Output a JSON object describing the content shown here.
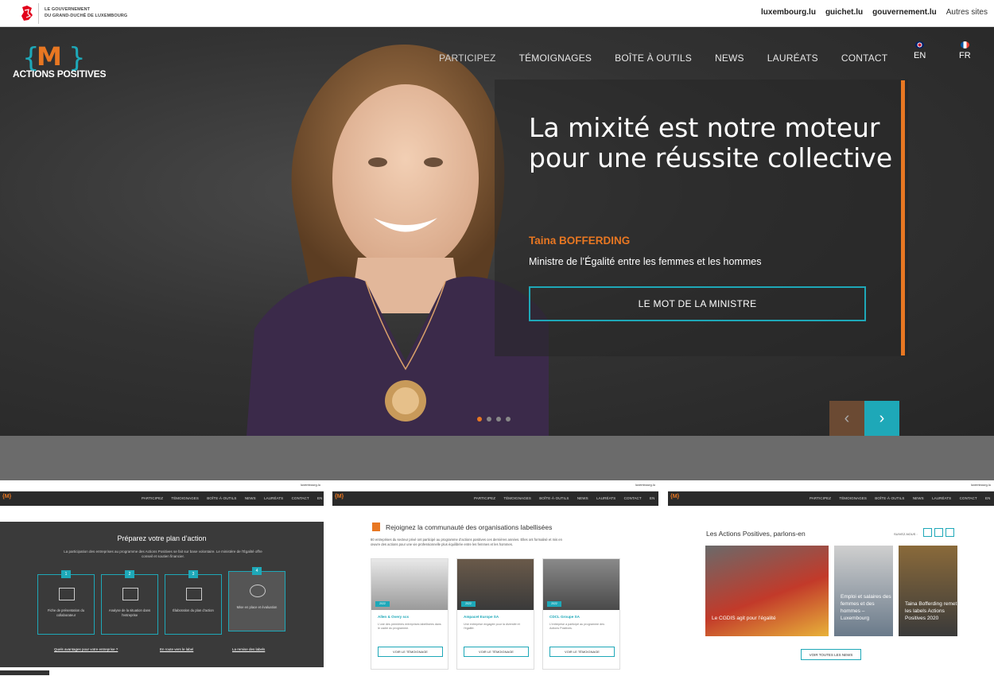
{
  "gov_bar": {
    "logo_text_line1": "LE GOUVERNEMENT",
    "logo_text_line2": "DU GRAND-DUCHÉ DE LUXEMBOURG",
    "links": [
      "luxembourg.lu",
      "guichet.lu",
      "gouvernement.lu"
    ],
    "other_sites": "Autres sites"
  },
  "brand": {
    "logo_mark": "{M}",
    "name": "ACTIONS POSITIVES"
  },
  "nav": {
    "items": [
      "PARTICIPEZ",
      "TÉMOIGNAGES",
      "BOÎTE À OUTILS",
      "NEWS",
      "LAURÉATS",
      "CONTACT"
    ],
    "lang_en": "EN",
    "lang_fr": "FR"
  },
  "hero": {
    "headline": "La mixité est notre moteur pour une réussite collective",
    "person_name": "Taina BOFFERDING",
    "person_role": "Ministre de l’Égalité entre les femmes et les hommes",
    "cta_label": "LE MOT DE LA MINISTRE",
    "slides_count": 4,
    "active_slide": 1
  },
  "thumb1": {
    "title": "Préparez votre plan d’action",
    "subtitle": "La participation des entreprises au programme des Actions Positives se fait sur base volontaire. Le ministère de l’Égalité offre conseil et soutien financier.",
    "steps": [
      {
        "num": "1",
        "label": "Fiche de présentation du collaborateur"
      },
      {
        "num": "2",
        "label": "Analyse de la situation dans l’entreprise"
      },
      {
        "num": "3",
        "label": "Élaboration du plan d’action"
      },
      {
        "num": "4",
        "label": "Mise en place et évaluation"
      }
    ],
    "links": [
      "Quels avantages pour votre entreprise ?",
      "En route vers le label",
      "La remise des labels"
    ]
  },
  "thumb2": {
    "title": "Rejoignez la communauté des organisations labellisées",
    "subtitle": "80 entreprises du secteur privé ont participé au programme d’actions positives ces dernières années. Elles ont formalisé et mis en œuvre des actions pour une vie professionnelle plus équilibrée entre les femmes et les hommes.",
    "cards": [
      {
        "year": "2022",
        "name": "Allen & Overy scs",
        "text": "L’une des premières entreprises labellisées dans le cadre du programme.",
        "button": "VOIR LE TÉMOIGNAGE"
      },
      {
        "year": "2022",
        "name": "Ampacet Europe SA",
        "text": "Une entreprise engagée pour la diversité et l’égalité.",
        "button": "VOIR LE TÉMOIGNAGE"
      },
      {
        "year": "2022",
        "name": "CDCL Groupe SA",
        "text": "L’entreprise a participé au programme des Actions Positives.",
        "button": "VOIR LE TÉMOIGNAGE"
      }
    ]
  },
  "thumb3": {
    "title": "Les Actions Positives, parlons-en",
    "follow": "SUIVEZ-NOUS :",
    "news": [
      {
        "caption": "Le CGDIS agit pour l’égalité"
      },
      {
        "caption": "Emploi et salaires des femmes et des hommes – Luxembourg"
      },
      {
        "caption": "Taina Bofferding remet les labels Actions Positives 2020"
      }
    ],
    "button": "VOIR TOUTES LES NEWS"
  },
  "colors": {
    "accent_teal": "#1ea8b8",
    "accent_orange": "#e87722",
    "hero_bg": "#333333"
  }
}
